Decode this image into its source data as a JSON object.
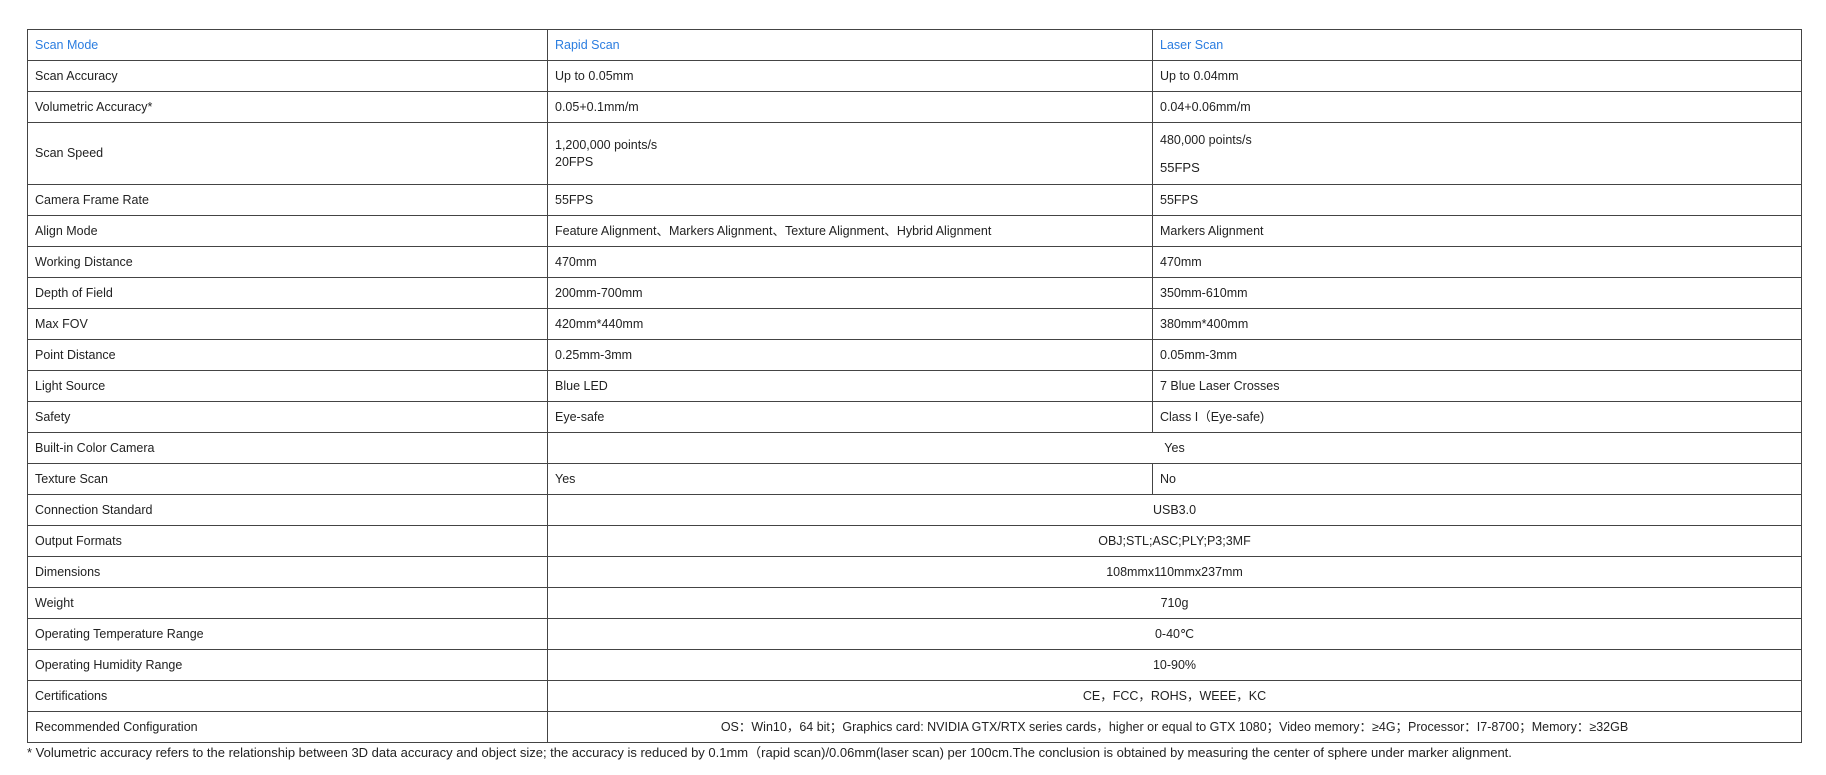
{
  "header": {
    "col1": "Scan Mode",
    "col2": "Rapid Scan",
    "col3": "Laser Scan"
  },
  "rows": [
    {
      "label": "Scan Accuracy",
      "rapid": "Up to 0.05mm",
      "laser": "Up to 0.04mm"
    },
    {
      "label": "Volumetric Accuracy*",
      "rapid": "0.05+0.1mm/m",
      "laser": "0.04+0.06mm/m"
    },
    {
      "label": "Scan Speed",
      "rapid": "1,200,000 points/s",
      "rapid_line2": "20FPS",
      "laser": "480,000 points/s",
      "laser_line2": "55FPS"
    },
    {
      "label": "Camera Frame Rate",
      "rapid": "55FPS",
      "laser": "55FPS"
    },
    {
      "label": "Align Mode",
      "rapid": "Feature Alignment、Markers Alignment、Texture Alignment、Hybrid Alignment",
      "laser": "Markers Alignment"
    },
    {
      "label": "Working Distance",
      "rapid": "470mm",
      "laser": "470mm"
    },
    {
      "label": "Depth of Field",
      "rapid": "200mm-700mm",
      "laser": "350mm-610mm"
    },
    {
      "label": "Max FOV",
      "rapid": "420mm*440mm",
      "laser": "380mm*400mm"
    },
    {
      "label": "Point Distance",
      "rapid": "0.25mm-3mm",
      "laser": "0.05mm-3mm"
    },
    {
      "label": "Light Source",
      "rapid": "Blue LED",
      "laser": "7 Blue Laser Crosses"
    },
    {
      "label": "Safety",
      "rapid": "Eye-safe",
      "laser": "Class I（Eye-safe)"
    },
    {
      "label": "Built-in Color Camera",
      "both": "Yes"
    },
    {
      "label": "Texture Scan",
      "rapid": "Yes",
      "laser": "No"
    },
    {
      "label": "Connection Standard",
      "both": "USB3.0"
    },
    {
      "label": "Output Formats",
      "both": "OBJ;STL;ASC;PLY;P3;3MF"
    },
    {
      "label": "Dimensions",
      "both": "108mmx110mmx237mm"
    },
    {
      "label": "Weight",
      "both": "710g"
    },
    {
      "label": "Operating Temperature Range",
      "both": "0-40℃"
    },
    {
      "label": "Operating Humidity Range",
      "both": "10-90%"
    },
    {
      "label": "Certifications",
      "both": "CE，FCC，ROHS，WEEE，KC"
    },
    {
      "label": "Recommended Configuration",
      "both": "OS：Win10，64 bit；Graphics card: NVIDIA GTX/RTX series cards，higher or equal to GTX 1080；Video memory：≥4G；Processor：I7-8700；Memory：≥32GB"
    }
  ],
  "footnote": "* Volumetric accuracy refers to the relationship between 3D data accuracy and object size; the accuracy is reduced by 0.1mm（rapid scan)/0.06mm(laser scan) per 100cm.The conclusion is obtained by measuring the center of sphere under marker alignment.",
  "colors": {
    "header_text": "#2b7de0",
    "border": "#444444",
    "text": "#222222"
  }
}
